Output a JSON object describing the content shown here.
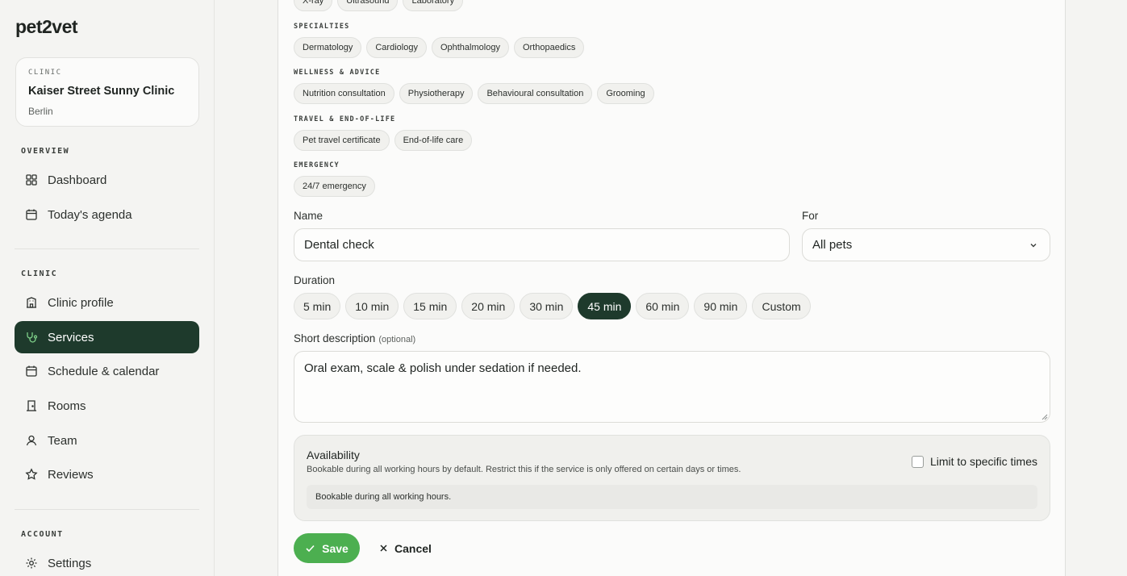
{
  "brand": {
    "logo": "pet2vet"
  },
  "clinic": {
    "eyebrow": "CLINIC",
    "name": "Kaiser Street Sunny Clinic",
    "city": "Berlin"
  },
  "sidebar": {
    "overview_label": "OVERVIEW",
    "overview_items": [
      {
        "label": "Dashboard",
        "icon": "grid-icon"
      },
      {
        "label": "Today's agenda",
        "icon": "calendar-icon"
      }
    ],
    "clinic_label": "CLINIC",
    "clinic_items": [
      {
        "label": "Clinic profile",
        "icon": "building-icon"
      },
      {
        "label": "Services",
        "icon": "stethoscope-icon",
        "active": true
      },
      {
        "label": "Schedule & calendar",
        "icon": "calendar-icon"
      },
      {
        "label": "Rooms",
        "icon": "door-icon"
      },
      {
        "label": "Team",
        "icon": "user-icon"
      },
      {
        "label": "Reviews",
        "icon": "star-icon"
      }
    ],
    "account_label": "ACCOUNT",
    "account_items": [
      {
        "label": "Settings",
        "icon": "gear-icon"
      }
    ]
  },
  "categories": {
    "diagnostics_chips": [
      "X-ray",
      "Ultrasound",
      "Laboratory"
    ],
    "specialties": {
      "label": "SPECIALTIES",
      "chips": [
        "Dermatology",
        "Cardiology",
        "Ophthalmology",
        "Orthopaedics"
      ]
    },
    "wellness": {
      "label": "WELLNESS & ADVICE",
      "chips": [
        "Nutrition consultation",
        "Physiotherapy",
        "Behavioural consultation",
        "Grooming"
      ]
    },
    "travel": {
      "label": "TRAVEL & END-OF-LIFE",
      "chips": [
        "Pet travel certificate",
        "End-of-life care"
      ]
    },
    "emergency": {
      "label": "EMERGENCY",
      "chips": [
        "24/7 emergency"
      ]
    }
  },
  "form": {
    "name_label": "Name",
    "name_value": "Dental check",
    "for_label": "For",
    "for_value": "All pets",
    "duration_label": "Duration",
    "durations": [
      "5 min",
      "10 min",
      "15 min",
      "20 min",
      "30 min",
      "45 min",
      "60 min",
      "90 min",
      "Custom"
    ],
    "duration_selected": "45 min",
    "desc_label": "Short description",
    "desc_optional": "(optional)",
    "desc_value": "Oral exam, scale & polish under sedation if needed.",
    "availability": {
      "title": "Availability",
      "description": "Bookable during all working hours by default. Restrict this if the service is only offered on certain days or times.",
      "checkbox_label": "Limit to specific times",
      "status": "Bookable during all working hours."
    },
    "save_label": "Save",
    "cancel_label": "Cancel"
  },
  "colors": {
    "primary": "#1e3a2c",
    "save": "#4caf50"
  }
}
